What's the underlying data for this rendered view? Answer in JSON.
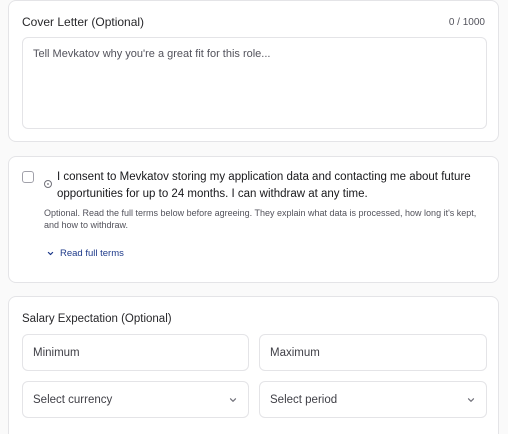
{
  "cover_letter": {
    "label": "Cover Letter (Optional)",
    "counter": "0 / 1000",
    "placeholder": "Tell Mevkatov why you're a great fit for this role..."
  },
  "consent": {
    "checked": false,
    "text": "I consent to Mevkatov storing my application data and contacting me about future opportunities for up to 24 months. I can withdraw at any time.",
    "note": "Optional. Read the full terms below before agreeing. They explain what data is processed, how long it's kept, and how to withdraw.",
    "full_terms_label": "Read full terms"
  },
  "salary": {
    "label": "Salary Expectation (Optional)",
    "minimum_placeholder": "Minimum",
    "maximum_placeholder": "Maximum",
    "currency_placeholder": "Select currency",
    "period_placeholder": "Select period"
  }
}
